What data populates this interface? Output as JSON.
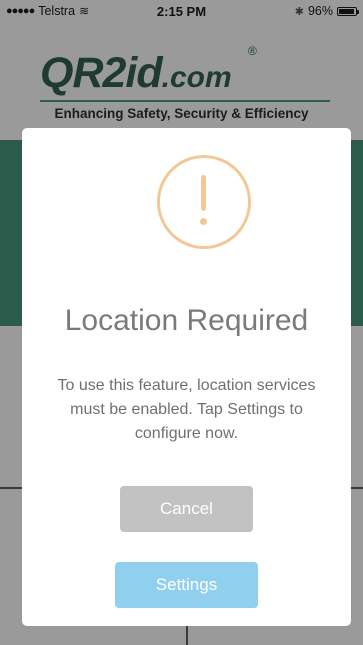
{
  "status_bar": {
    "carrier": "Telstra",
    "time": "2:15 PM",
    "battery": "96%",
    "battery_level": 0.96
  },
  "logo": {
    "brand": "QR2id",
    "suffix": ".com",
    "registered": "®",
    "tagline": "Enhancing Safety, Security & Efficiency"
  },
  "dialog": {
    "icon": "exclamation-circle-icon",
    "icon_color": "#f2c896",
    "title": "Location Required",
    "message": "To use this feature, location services must be enabled. Tap Settings to configure now.",
    "cancel_label": "Cancel",
    "settings_label": "Settings",
    "cancel_color": "#c2c2c2",
    "settings_color": "#90d0ee"
  },
  "colors": {
    "brand_dark": "#1e3a32",
    "teal": "#2c5b4c"
  }
}
